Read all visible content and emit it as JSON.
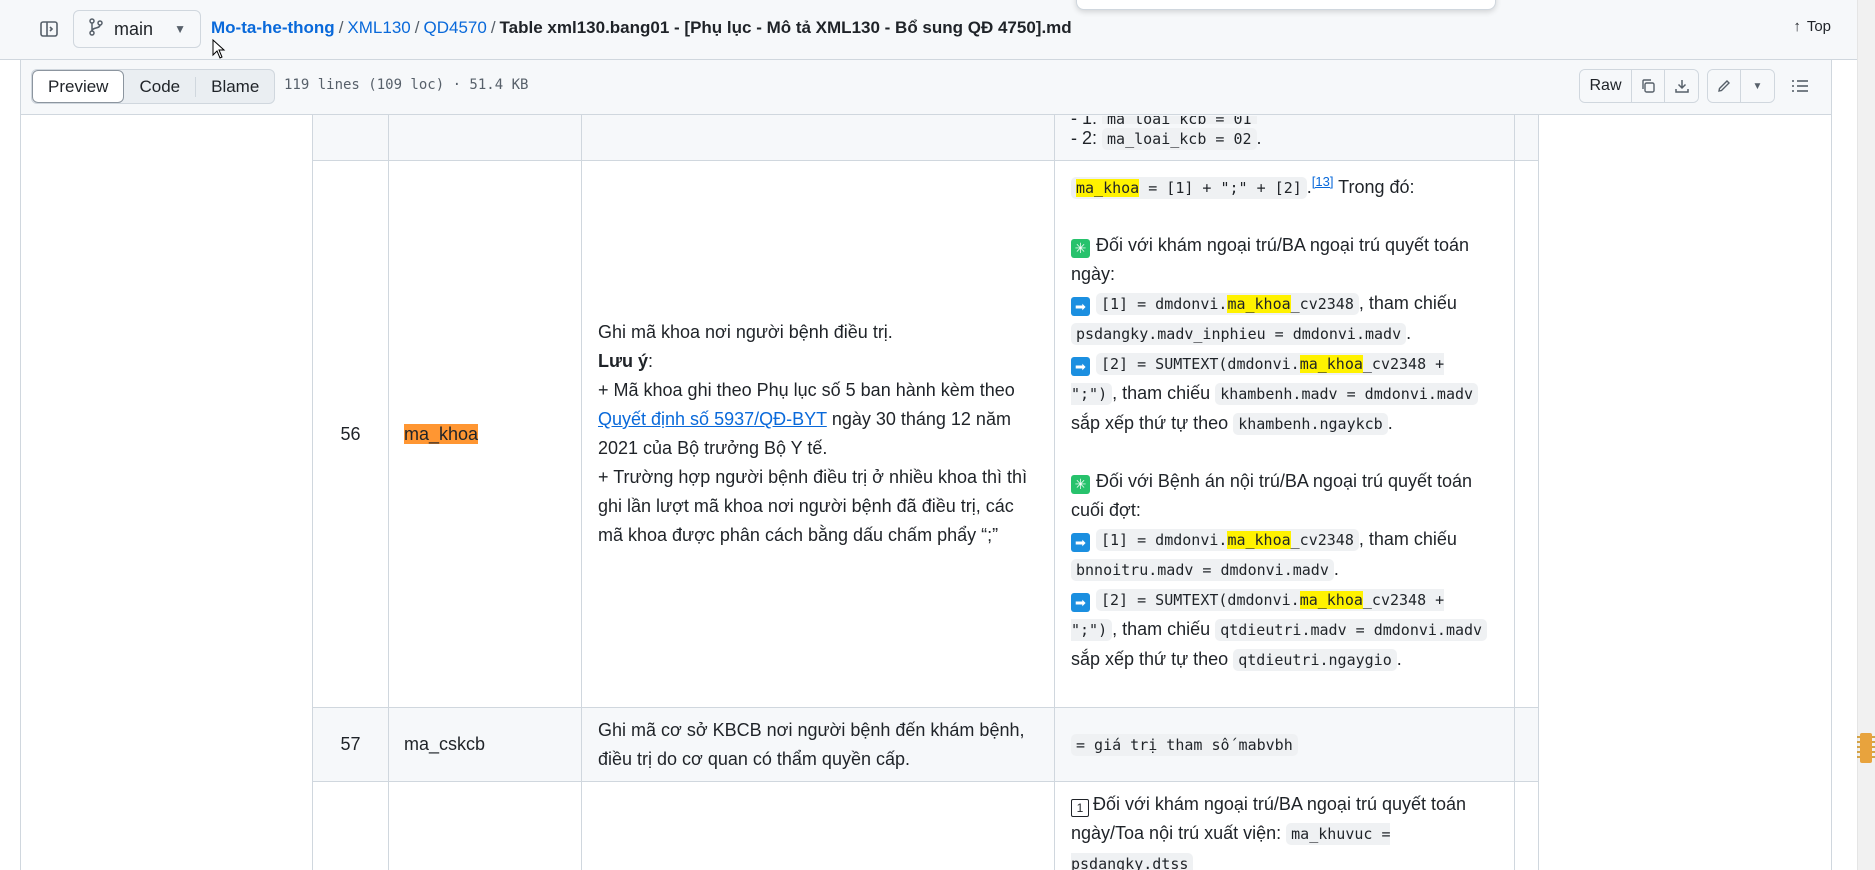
{
  "header": {
    "branch": "main",
    "breadcrumb": [
      "Mo-ta-he-thong",
      "XML130",
      "QD4570"
    ],
    "breadcrumb_sep": "/",
    "current_file": "Table xml130.bang01 - [Phụ lục - Mô tả XML130 - Bổ sung QĐ 4750].md",
    "top_label": "Top"
  },
  "toolbar": {
    "tabs": [
      "Preview",
      "Code",
      "Blame"
    ],
    "file_meta": "119 lines (109 loc) · 51.4 KB",
    "raw_label": "Raw"
  },
  "rows": {
    "r0": {
      "line_prefix": "- 1:",
      "line_prefix_code": "ma_loai_kcb = 01",
      "line2_text": "- 2:",
      "line2_code": "ma_loai_kcb = 02",
      "period": "."
    },
    "r56": {
      "no": "56",
      "field": "ma_khoa",
      "desc_line1": "Ghi mã khoa nơi người bệnh điều trị.",
      "desc_note": "Lưu ý",
      "desc_colon": ":",
      "desc_p1a": "+ Mã khoa ghi theo Phụ lục số 5 ban hành kèm theo ",
      "desc_link1": "Quyết định số 5937",
      "desc_link2": "/QĐ-BYT",
      "desc_p1b": " ngày 30 tháng 12 năm 2021 của Bộ trưởng Bộ Y tế.",
      "desc_p2": "+ Trường hợp người bệnh điều trị ở nhiều khoa thì thì ghi lần lượt mã khoa nơi người bệnh đã điều trị, các mã khoa được phân cách bằng dấu chấm phẩy “;”",
      "f_hl": "ma_khoa",
      "f_code": " = [1] + \";\" + [2]",
      "f_dot": ".",
      "f_sup": "[13]",
      "f_tail": " Trong đó:",
      "s1_title": "Đối với khám ngoại trú/BA ngoại trú quyết toán ngày:",
      "s1_l1_pre": "[1] = dmdonvi.",
      "s1_l1_hl": "ma_khoa",
      "s1_l1_post": "_cv2348",
      "s1_l1_text": ", tham chiếu ",
      "s1_l1_ref": "psdangky.madv_inphieu = dmdonvi.madv",
      "s1_l2_pre": "[2] = SUMTEXT(dmdonvi.",
      "s1_l2_hl": "ma_khoa",
      "s1_l2_post": "_cv2348 + \";\")",
      "s1_l2_text": ", tham chiếu ",
      "s1_l2_ref": "khambenh.madv = dmdonvi.madv",
      "s1_l2_sort": " sắp xếp thứ tự theo ",
      "s1_l2_sortref": "khambenh.ngaykcb",
      "s2_title": "Đối với Bệnh án nội trú/BA ngoại trú quyết toán cuối đợt:",
      "s2_l1_pre": "[1] = dmdonvi.",
      "s2_l1_hl": "ma_khoa",
      "s2_l1_post": "_cv2348",
      "s2_l1_text": ", tham chiếu ",
      "s2_l1_ref": "bnnoitru.madv = dmdonvi.madv",
      "s2_l2_pre": "[2] = SUMTEXT(dmdonvi.",
      "s2_l2_hl": "ma_khoa",
      "s2_l2_post": "_cv2348 + \";\")",
      "s2_l2_text": ", tham chiếu ",
      "s2_l2_ref": "qtdieutri.madv = dmdonvi.madv",
      "s2_l2_sort": " sắp xếp thứ tự theo ",
      "s2_l2_sortref": "qtdieutri.ngaygio",
      "period": "."
    },
    "r57": {
      "no": "57",
      "field": "ma_cskcb",
      "desc": "Ghi mã cơ sở KBCB nơi người bệnh đến khám bệnh, điều trị do cơ quan có thẩm quyền cấp.",
      "value": "= giá trị tham số mabvbh"
    },
    "r58": {
      "box": "1",
      "text": "Đối với khám ngoại trú/BA ngoại trú quyết toán ngày/Toa nội trú xuất viện: ",
      "code": "ma_khuvuc = psdangky.dtss"
    }
  },
  "icons": {
    "sparkle": "✳",
    "arrow": "➡"
  }
}
